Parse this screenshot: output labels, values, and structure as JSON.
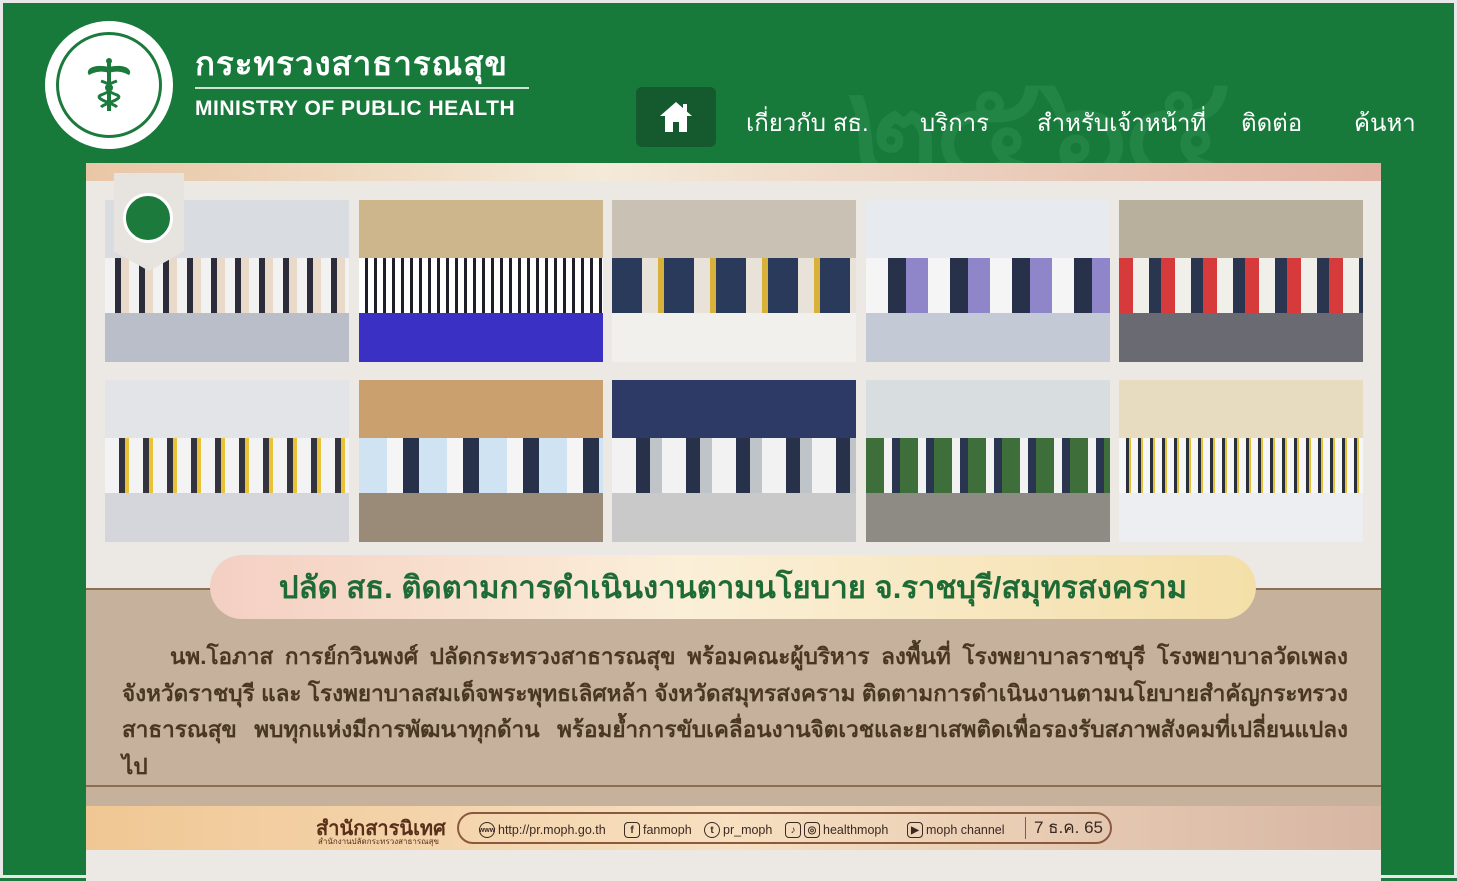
{
  "header": {
    "org_name_th": "กระทรวงสาธารณสุข",
    "org_name_en": "MINISTRY OF PUBLIC HEALTH",
    "logo_ring_text": "กระทรวงสาธารณสุข MINISTRY OF PUBLIC HEALTH",
    "nav": [
      {
        "label": "เกี่ยวกับ สธ."
      },
      {
        "label": "บริการ"
      },
      {
        "label": "สำหรับเจ้าหน้าที่"
      },
      {
        "label": "ติดต่อ"
      },
      {
        "label": "ค้นหา"
      }
    ],
    "home_icon": "home-icon",
    "colors": {
      "brand_green": "#177a3b",
      "home_button": "#145a2e"
    }
  },
  "news": {
    "photos": [
      {
        "name": "photo-hospital-corridor"
      },
      {
        "name": "photo-group-hall"
      },
      {
        "name": "photo-meeting-table"
      },
      {
        "name": "photo-ward-staff"
      },
      {
        "name": "photo-hospital-visit"
      },
      {
        "name": "photo-conference-room"
      },
      {
        "name": "photo-nurse-station"
      },
      {
        "name": "photo-exhibit-poster"
      },
      {
        "name": "photo-outdoor-walk"
      },
      {
        "name": "photo-group-meeting"
      }
    ],
    "headline": "ปลัด สธ. ติดตามการดำเนินงานตามนโยบาย จ.ราชบุรี/สมุทรสงคราม",
    "body": "นพ.โอภาส การย์กวินพงศ์ ปลัดกระทรวงสาธารณสุข พร้อมคณะผู้บริหาร ลงพื้นที่ โรงพยาบาลราชบุรี โรงพยาบาลวัดเพลง จังหวัดราชบุรี และ โรงพยาบาลสมเด็จพระพุทธเลิศหล้า จังหวัดสมุทรสงคราม ติดตามการดำเนินงานตามนโยบายสำคัญกระทรวงสาธารณสุข พบทุกแห่งมีการพัฒนาทุกด้าน พร้อมย้ำการขับเคลื่อนงานจิตเวชและยาเสพติดเพื่อรองรับสภาพสังคมที่เปลี่ยนแปลงไป"
  },
  "footer": {
    "org": "สำนักสารนิเทศ",
    "org_sub": "สำนักงานปลัดกระทรวงสาธารณสุข",
    "website": "http://pr.moph.go.th",
    "facebook": "fanmoph",
    "twitter": "pr_moph",
    "tiktok_instagram": "healthmoph",
    "youtube": "moph channel",
    "date": "7 ธ.ค. 65"
  }
}
